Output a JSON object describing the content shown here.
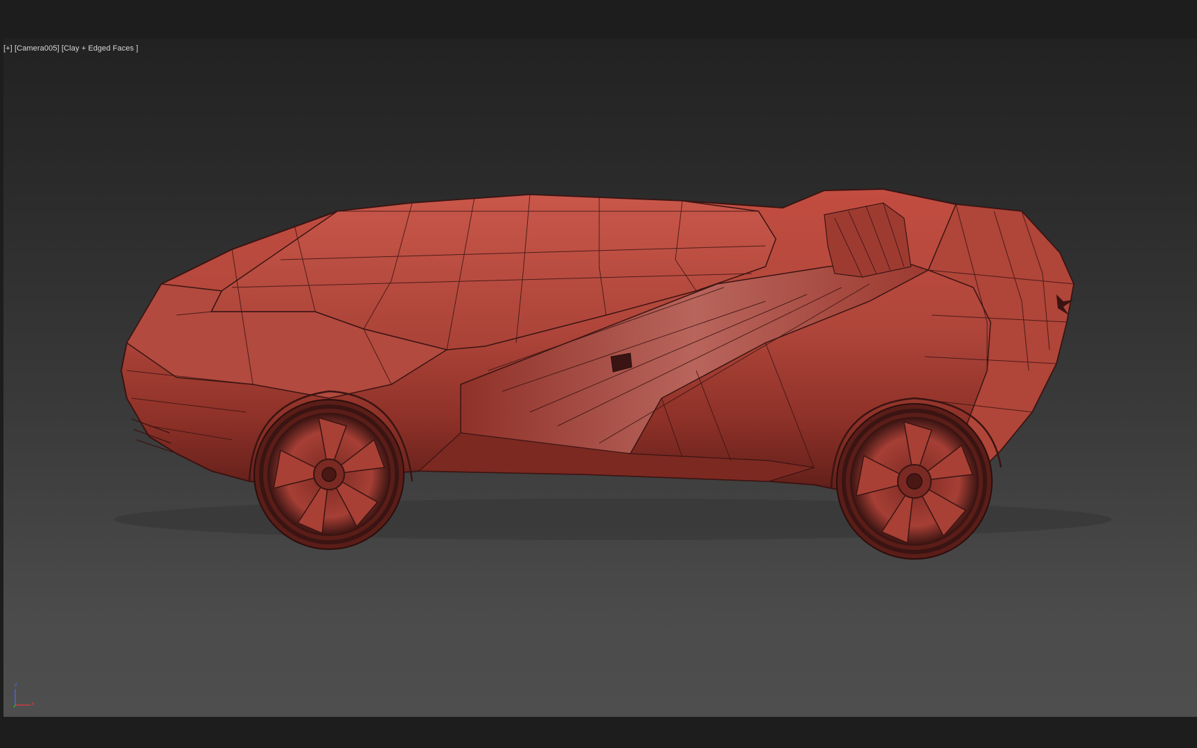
{
  "viewport": {
    "label_plus": "[+]",
    "label_camera": "[Camera005]",
    "label_shading": "[Clay + Edged Faces ]",
    "model": {
      "name": "concept car",
      "color": "#b2443a",
      "edge_color": "#3a1412"
    }
  },
  "gizmo": {
    "z_label": "z",
    "x_label": "x",
    "z_color": "#4a6cff",
    "x_color": "#e03a3a",
    "y_color": "#3ac43a"
  },
  "colors": {
    "background_top": "#222222",
    "background_bottom": "#4e4e4e",
    "frame": "#1d1d1d"
  }
}
